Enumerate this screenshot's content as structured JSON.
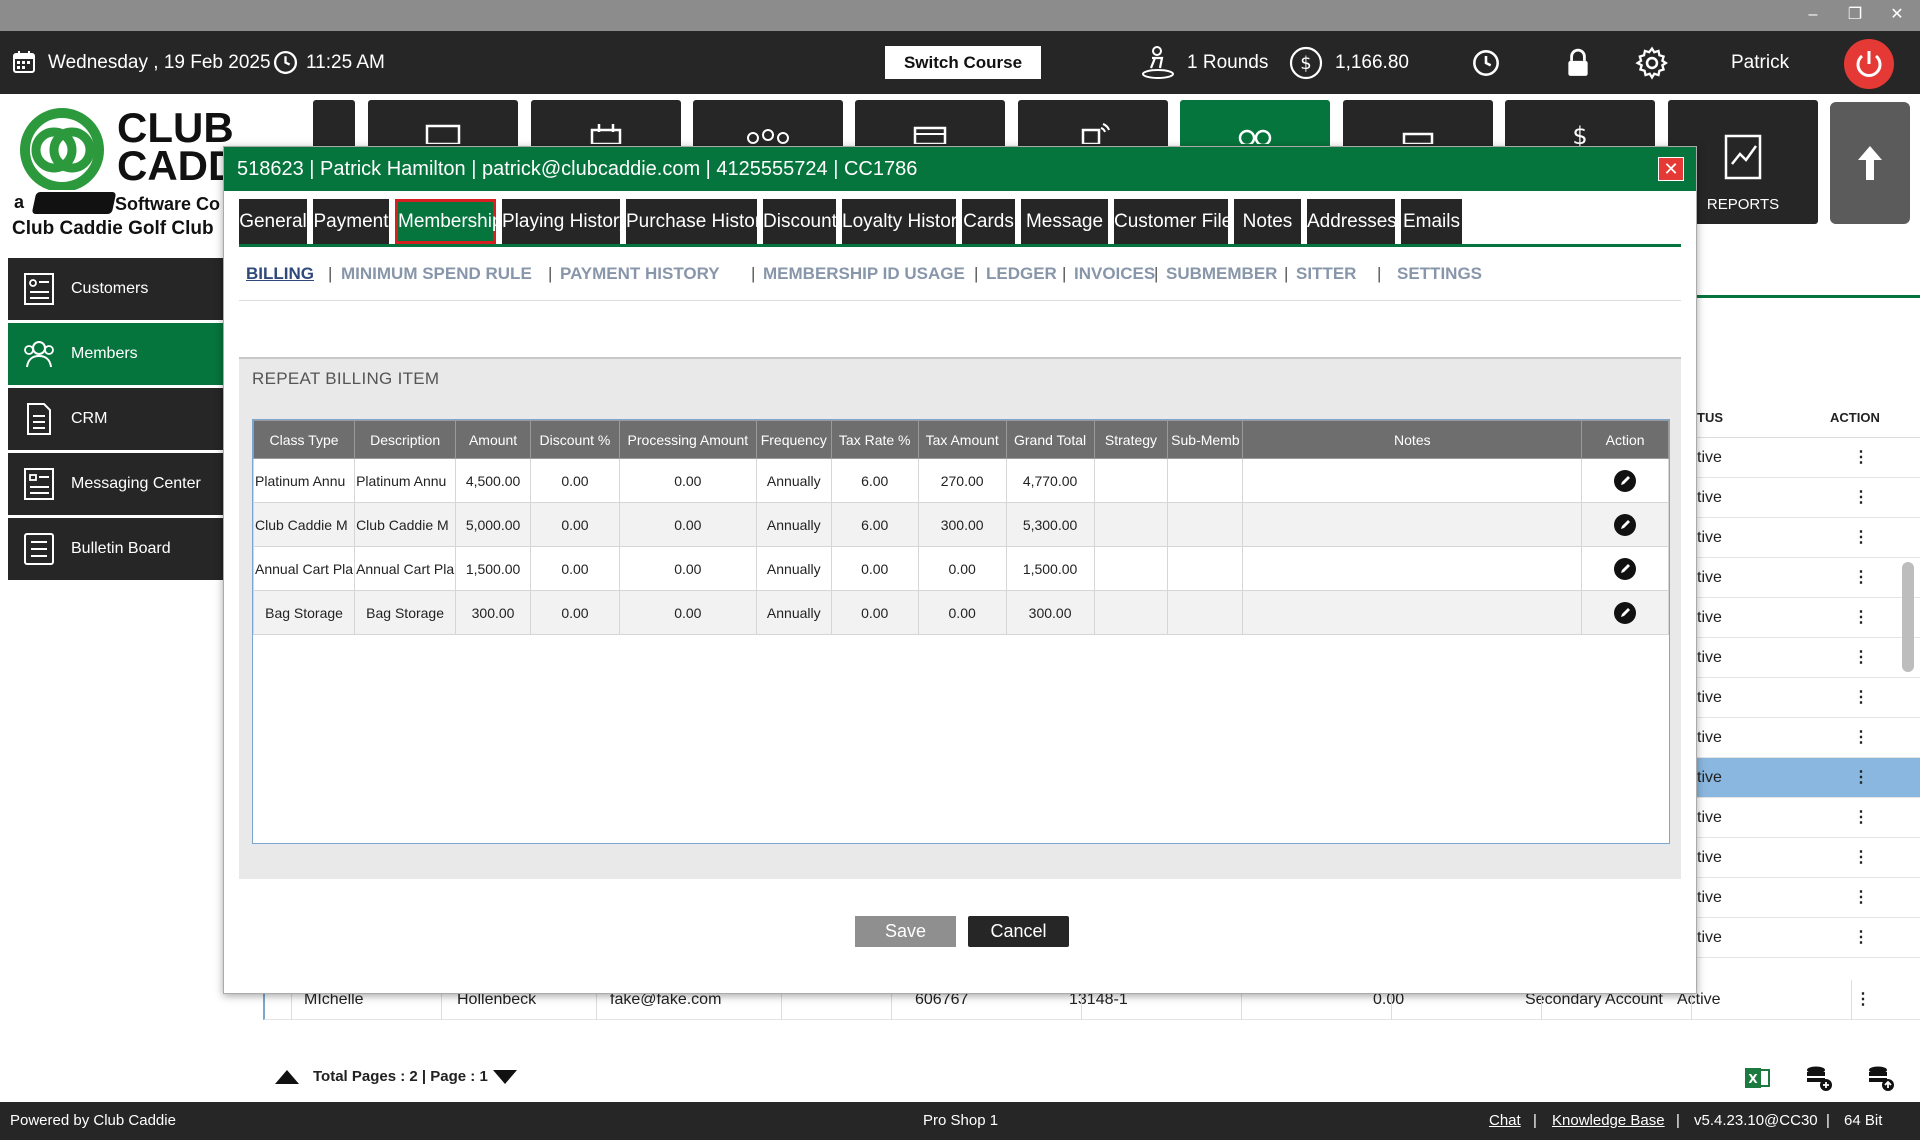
{
  "window": {
    "minimize": "–",
    "restore": "❐",
    "close": "✕"
  },
  "header": {
    "date": "Wednesday ,  19 Feb 2025",
    "time": "11:25 AM",
    "switch_course": "Switch Course",
    "rounds": "1 Rounds",
    "balance": "1,166.80",
    "user": "Patrick"
  },
  "reports_label": "REPORTS",
  "logo": {
    "line1": "CLUB",
    "line2": "CADDI",
    "tagline_prefix": "a",
    "tagline": "Software Co",
    "club_name": "Club Caddie Golf Club"
  },
  "sidebar": {
    "items": [
      {
        "label": "Customers"
      },
      {
        "label": "Members"
      },
      {
        "label": "CRM"
      },
      {
        "label": "Messaging Center"
      },
      {
        "label": "Bulletin Board"
      }
    ]
  },
  "background_table": {
    "headers": {
      "status": "TUS",
      "action": "ACTION"
    },
    "status_value": "tive",
    "action_glyph": "⋮",
    "last_row": {
      "first": "MIchelle",
      "last": "Hollenbeck",
      "email": "fake@fake.com",
      "phone": "606767",
      "member_id": "13148-1",
      "balance": "0.00",
      "type": "Secondary Account",
      "status": "Active"
    }
  },
  "pager": {
    "text": "Total Pages : 2 | Page : 1"
  },
  "footer": {
    "powered": "Powered by Club Caddie",
    "station": "Pro Shop 1",
    "chat": "Chat",
    "kb": "Knowledge Base",
    "version": "v5.4.23.10@CC30",
    "bits": "64 Bit",
    "sep": "|"
  },
  "modal": {
    "title": "518623 | Patrick Hamilton | patrick@clubcaddie.com | 4125555724 | CC1786",
    "close": "✕",
    "tabs": [
      {
        "label": "General"
      },
      {
        "label": "Payment"
      },
      {
        "label": "Membership"
      },
      {
        "label": "Playing History"
      },
      {
        "label": "Purchase History"
      },
      {
        "label": "Discount"
      },
      {
        "label": "Loyalty History"
      },
      {
        "label": "Cards"
      },
      {
        "label": "Message"
      },
      {
        "label": "Customer File"
      },
      {
        "label": "Notes"
      },
      {
        "label": "Addresses"
      },
      {
        "label": "Emails"
      }
    ],
    "subtabs": [
      {
        "label": "BILLING"
      },
      {
        "label": "MINIMUM SPEND RULE"
      },
      {
        "label": "PAYMENT HISTORY"
      },
      {
        "label": "MEMBERSHIP ID USAGE"
      },
      {
        "label": "LEDGER"
      },
      {
        "label": "INVOICES"
      },
      {
        "label": "SUBMEMBER"
      },
      {
        "label": "SITTER"
      },
      {
        "label": "SETTINGS"
      }
    ],
    "panel_title": "REPEAT BILLING ITEM",
    "columns": [
      "Class Type",
      "Description",
      "Amount",
      "Discount %",
      "Processing Amount",
      "Frequency",
      "Tax Rate %",
      "Tax Amount",
      "Grand Total",
      "Strategy",
      "Sub-Memb",
      "Notes",
      "Action"
    ],
    "rows": [
      {
        "class_type": "Platinum Annu",
        "description": "Platinum Annu",
        "amount": "4,500.00",
        "discount": "0.00",
        "processing": "0.00",
        "frequency": "Annually",
        "tax_rate": "6.00",
        "tax_amount": "270.00",
        "grand_total": "4,770.00",
        "strategy": "",
        "sub_member": "",
        "notes": ""
      },
      {
        "class_type": "Club Caddie M",
        "description": "Club Caddie M",
        "amount": "5,000.00",
        "discount": "0.00",
        "processing": "0.00",
        "frequency": "Annually",
        "tax_rate": "6.00",
        "tax_amount": "300.00",
        "grand_total": "5,300.00",
        "strategy": "",
        "sub_member": "",
        "notes": ""
      },
      {
        "class_type": "Annual Cart Pla",
        "description": "Annual Cart Pla",
        "amount": "1,500.00",
        "discount": "0.00",
        "processing": "0.00",
        "frequency": "Annually",
        "tax_rate": "0.00",
        "tax_amount": "0.00",
        "grand_total": "1,500.00",
        "strategy": "",
        "sub_member": "",
        "notes": ""
      },
      {
        "class_type": "Bag Storage",
        "description": "Bag Storage",
        "amount": "300.00",
        "discount": "0.00",
        "processing": "0.00",
        "frequency": "Annually",
        "tax_rate": "0.00",
        "tax_amount": "0.00",
        "grand_total": "300.00",
        "strategy": "",
        "sub_member": "",
        "notes": ""
      }
    ],
    "save": "Save",
    "cancel": "Cancel"
  },
  "colors": {
    "brand_green": "#06753d",
    "dark": "#262626",
    "alert_red": "#e53935",
    "selection_blue": "#8ab7df"
  }
}
